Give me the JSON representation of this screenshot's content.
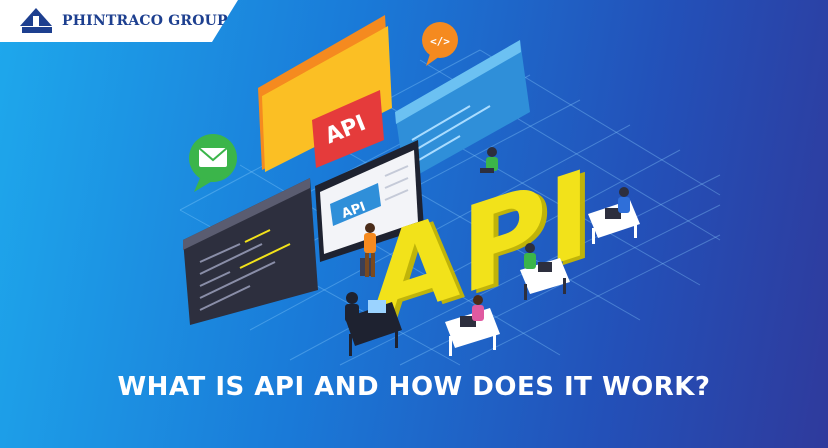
{
  "brand": {
    "name": "PHINTRACO GROUP",
    "logo_icon": "phintraco-logo-icon"
  },
  "headline": "WHAT IS API AND HOW DOES IT WORK?",
  "illustration": {
    "api_badge_label": "API",
    "monitor_label": "API",
    "big_3d_letters": "API",
    "code_bubble_label": "</>",
    "mail_bubble_icon": "envelope-icon"
  },
  "colors": {
    "background_start": "#1ea8ec",
    "background_end": "#2f3a9c",
    "api_letters": "#f2e21a",
    "api_badge": "#e53b3b",
    "folder": "#f9a825",
    "brand_navy": "#1d3f8f"
  }
}
